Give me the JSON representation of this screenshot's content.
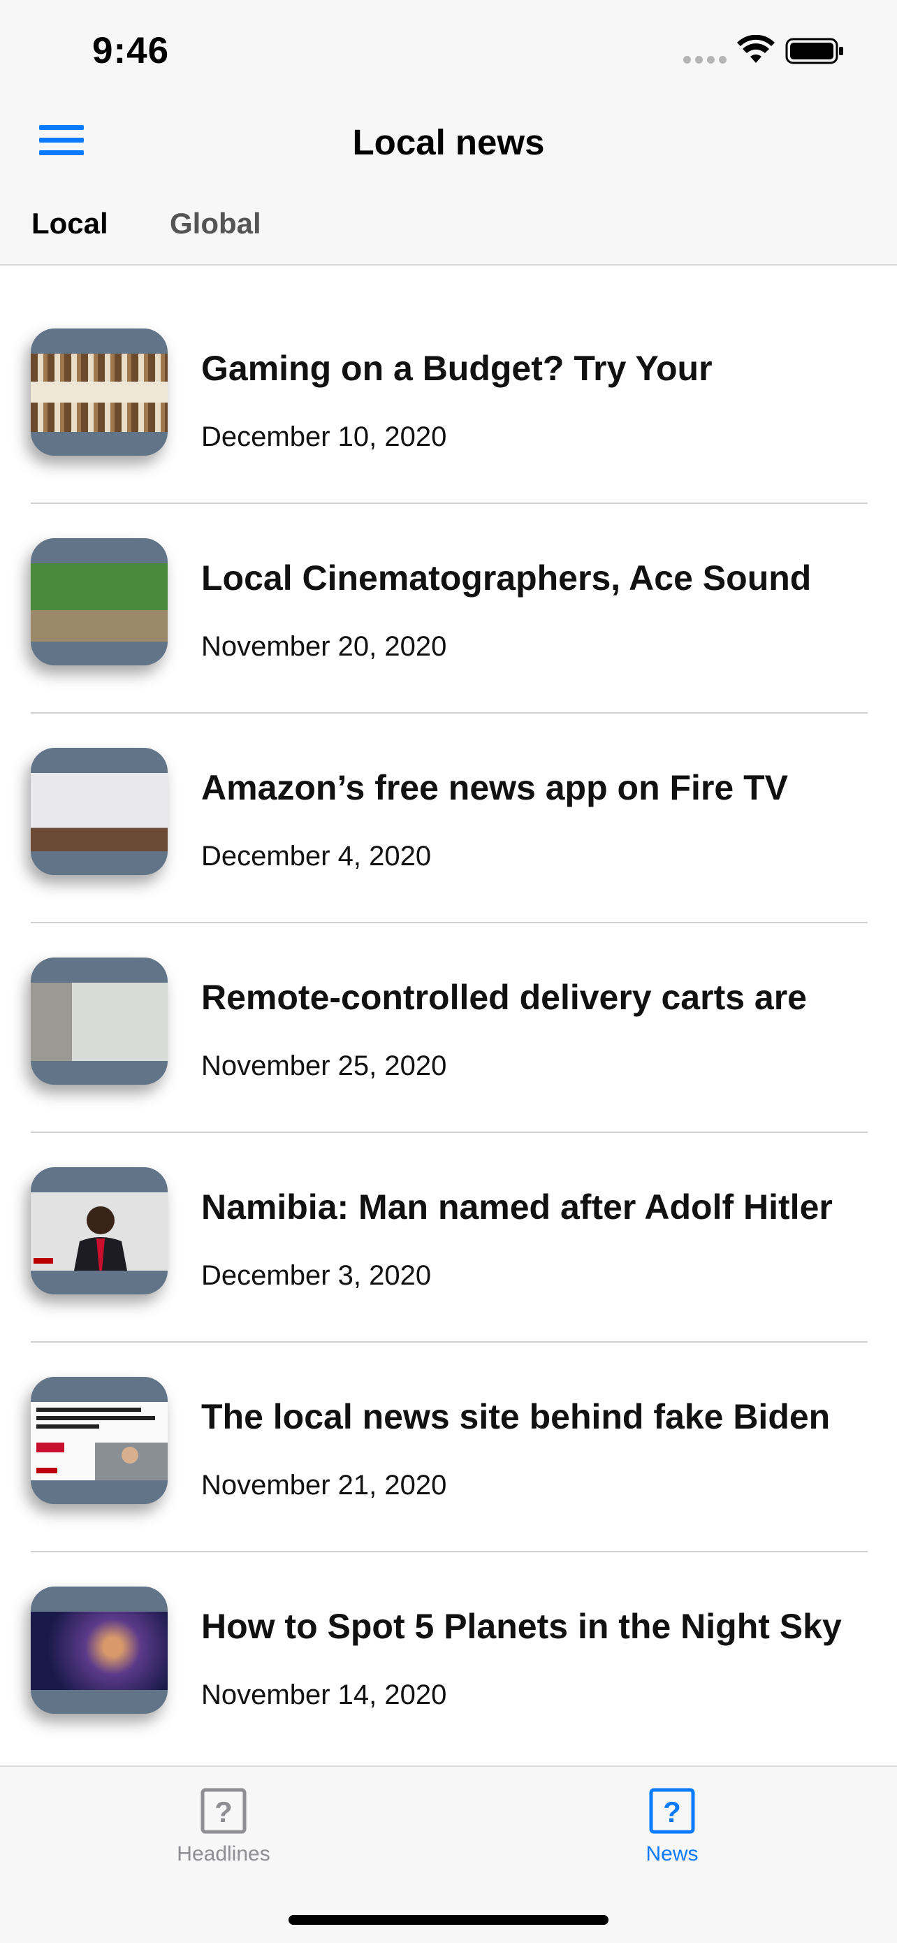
{
  "status_bar": {
    "time": "9:46"
  },
  "nav": {
    "title": "Local news"
  },
  "tabs": [
    {
      "label": "Local",
      "selected": true
    },
    {
      "label": "Global",
      "selected": false
    }
  ],
  "news": [
    {
      "title": "Gaming on a Budget? Try Your",
      "date": "December 10, 2020"
    },
    {
      "title": "Local Cinematographers, Ace Sound",
      "date": "November 20, 2020"
    },
    {
      "title": "Amazon’s free news app on Fire TV",
      "date": "December 4, 2020"
    },
    {
      "title": "Remote-controlled delivery carts are",
      "date": "November 25, 2020"
    },
    {
      "title": "Namibia: Man named after Adolf Hitler",
      "date": "December 3, 2020"
    },
    {
      "title": "The local news site behind fake Biden",
      "date": "November 21, 2020"
    },
    {
      "title": "How to Spot 5 Planets in the Night Sky",
      "date": "November 14, 2020"
    }
  ],
  "tab_bar": {
    "items": [
      {
        "label": "Headlines",
        "icon": "question-mark-square-icon",
        "selected": false
      },
      {
        "label": "News",
        "icon": "question-mark-square-icon",
        "selected": true
      }
    ]
  },
  "colors": {
    "accent": "#0a7aff",
    "thumbnail_bg": "#627487",
    "inactive": "#8e8e93"
  }
}
